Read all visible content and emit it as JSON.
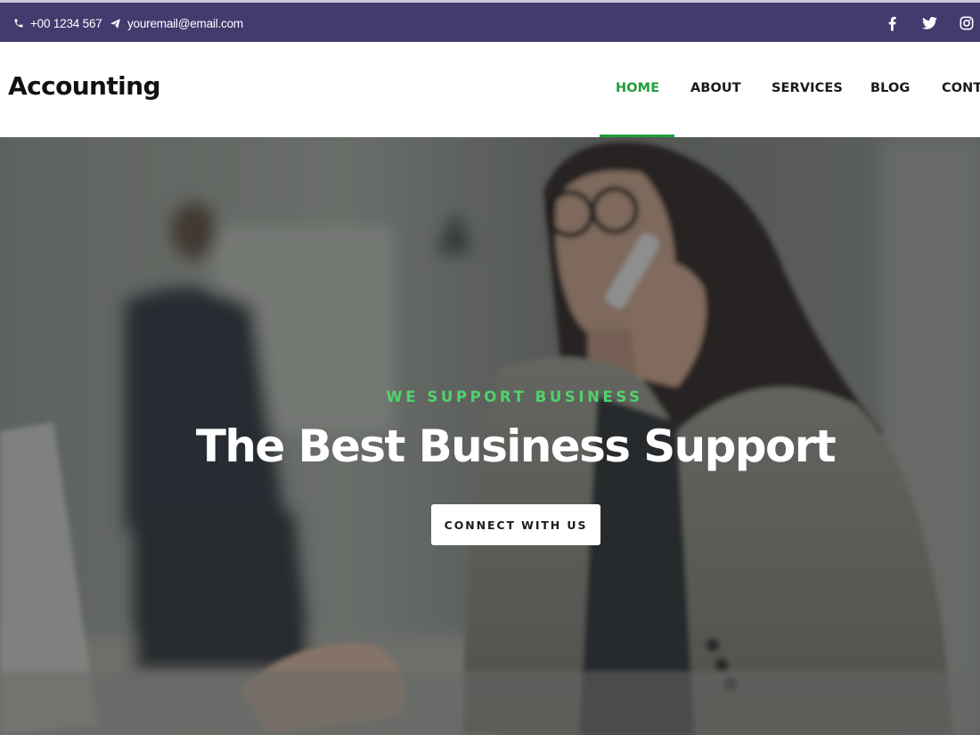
{
  "topbar": {
    "phone": {
      "icon": "phone-icon",
      "text": "+00 1234 567"
    },
    "email": {
      "icon": "paper-plane-icon",
      "text": "youremail@email.com"
    },
    "social": [
      "facebook-icon",
      "twitter-icon",
      "instagram-icon"
    ]
  },
  "header": {
    "logo": "Accounting",
    "nav": [
      {
        "label": "HOME",
        "active": true
      },
      {
        "label": "ABOUT",
        "active": false
      },
      {
        "label": "SERVICES",
        "active": false
      },
      {
        "label": "BLOG",
        "active": false
      },
      {
        "label": "CONT",
        "active": false
      }
    ]
  },
  "hero": {
    "eyebrow": "WE SUPPORT BUSINESS",
    "title": "The Best Business Support",
    "cta_label": "CONNECT WITH US"
  },
  "colors": {
    "topbar_bg": "#433a6e",
    "accent_green": "#1f9d3a",
    "eyebrow_green": "#4fd36b",
    "text_dark": "#111111"
  }
}
